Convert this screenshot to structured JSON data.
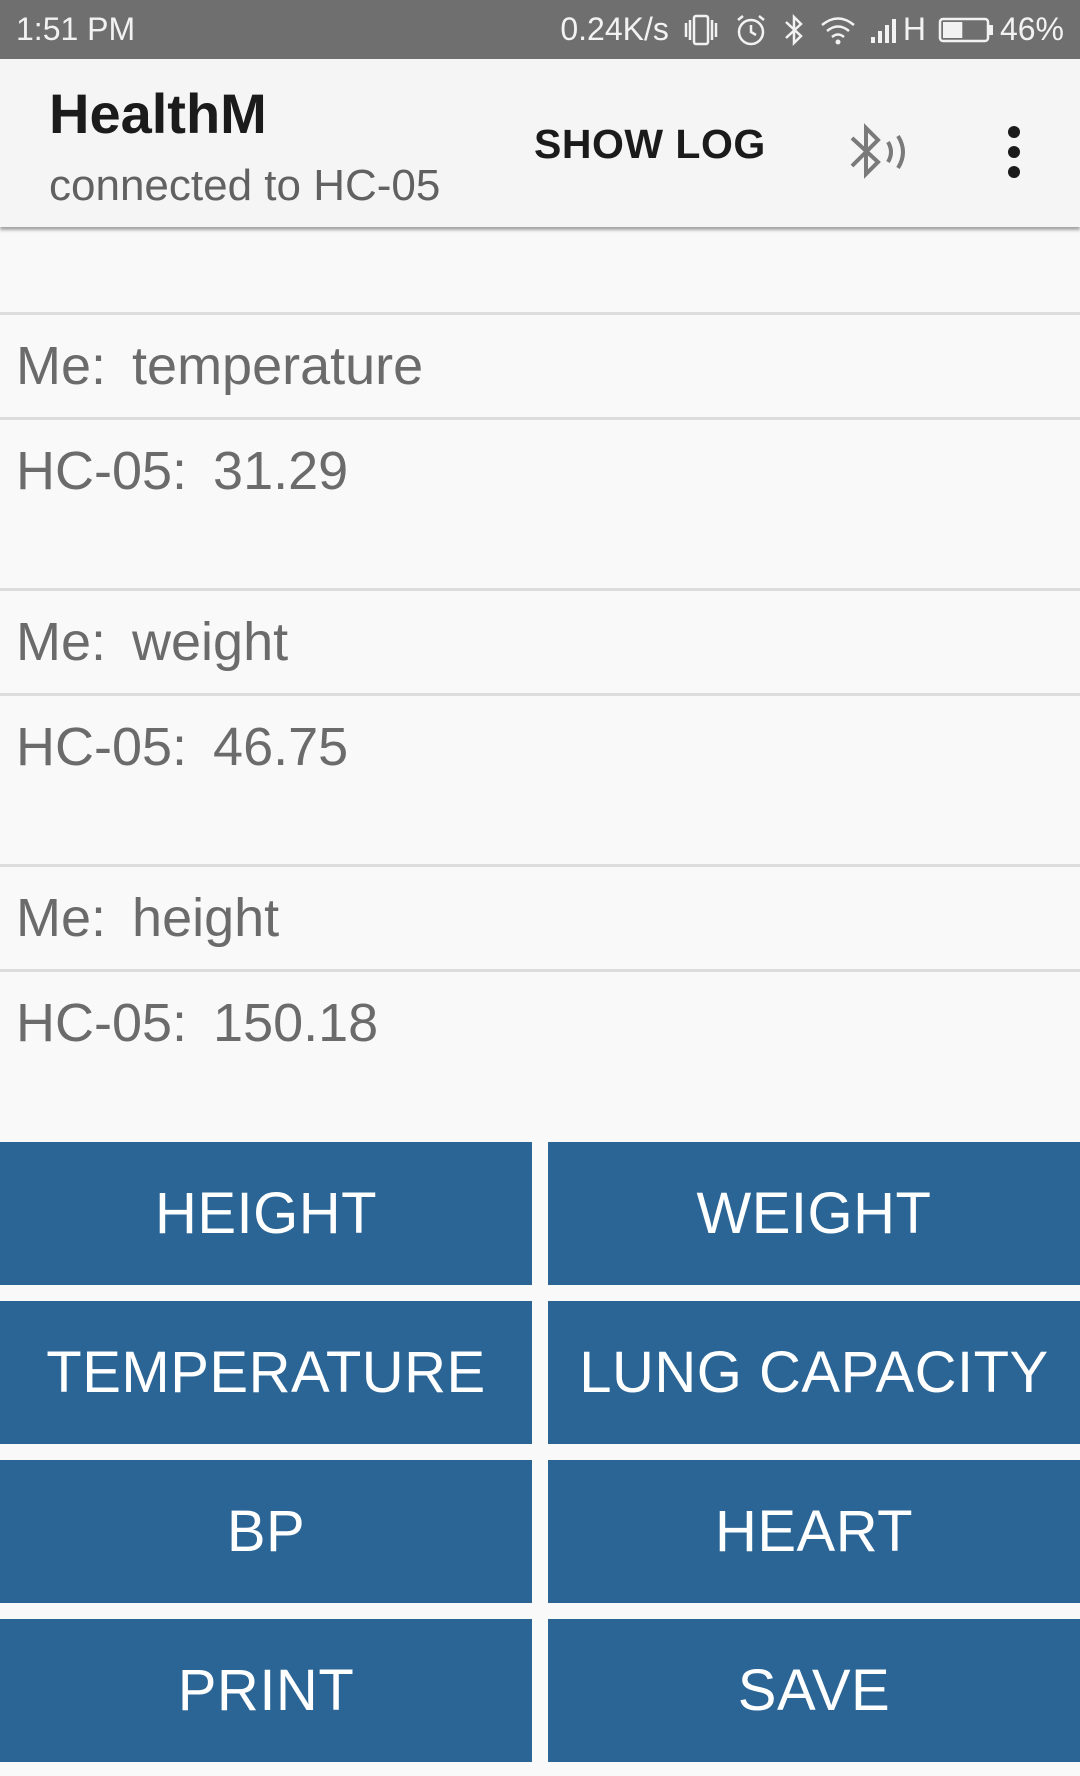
{
  "status_bar": {
    "time": "1:51 PM",
    "network_speed": "0.24K/s",
    "network_type": "H",
    "battery": "46%",
    "battery_level": 0.46,
    "icons": [
      "vibrate-icon",
      "alarm-icon",
      "bluetooth-icon",
      "wifi-icon",
      "signal-icon",
      "battery-icon"
    ]
  },
  "app_bar": {
    "title": "HealthM",
    "subtitle": "connected to HC-05",
    "show_log_label": "SHOW LOG",
    "icons": [
      "bluetooth-connected-icon",
      "more-vert-icon"
    ]
  },
  "messages": [
    {
      "sender": "Me:",
      "text": "temperature"
    },
    {
      "sender": "HC-05:",
      "text": "31.29"
    },
    {
      "sender": "Me:",
      "text": "weight"
    },
    {
      "sender": "HC-05:",
      "text": "46.75"
    },
    {
      "sender": "Me:",
      "text": "height"
    },
    {
      "sender": "HC-05:",
      "text": "150.18"
    }
  ],
  "buttons": {
    "height": "HEIGHT",
    "weight": "WEIGHT",
    "temperature": "TEMPERATURE",
    "lung_capacity": "LUNG CAPACITY",
    "bp": "BP",
    "heart": "HEART",
    "print": "PRINT",
    "save": "SAVE"
  },
  "colors": {
    "status_bar_bg": "#6f6f6f",
    "app_bar_bg": "#f5f5f5",
    "button_bg": "#2a6596",
    "button_text": "#ffffff",
    "message_text": "#6b6b6b"
  }
}
